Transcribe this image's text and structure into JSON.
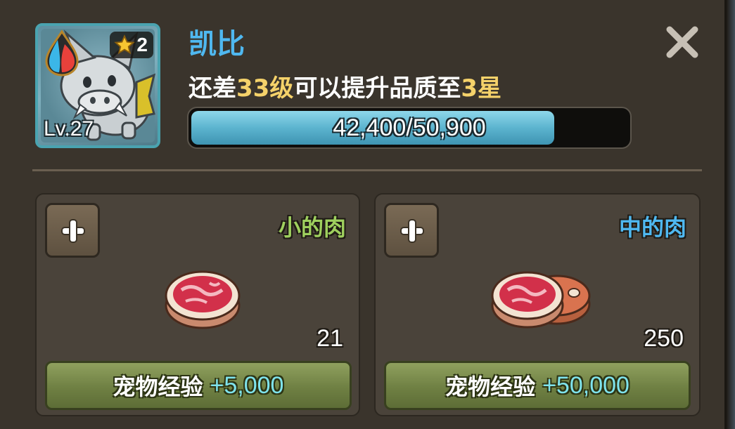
{
  "pet": {
    "name": "凯比",
    "level_label": "Lv.27",
    "star_count": "2",
    "element_icon": "water-fire-drop-icon",
    "portrait_icon": "gray-beast-pet-icon"
  },
  "upgrade": {
    "prefix": "还差",
    "levels": "33级",
    "middle": "可以提升品质至",
    "target": "3星"
  },
  "xp": {
    "current": 42400,
    "max": 50900,
    "text": "42,400/50,900"
  },
  "foods": [
    {
      "name": "小的肉",
      "count": "21",
      "exp_label": "宠物经验",
      "exp_value": "+5,000",
      "icon": "small-meat-icon",
      "name_color": "#9ecf5e"
    },
    {
      "name": "中的肉",
      "count": "250",
      "exp_label": "宠物经验",
      "exp_value": "+50,000",
      "icon": "medium-meat-icon",
      "name_color": "#4fb8f0"
    }
  ],
  "colors": {
    "highlight": "#f5d26a",
    "name_blue": "#4fb8f0",
    "exp_cyan": "#7fe3ec",
    "xp_fill": "#5cb4cf"
  }
}
